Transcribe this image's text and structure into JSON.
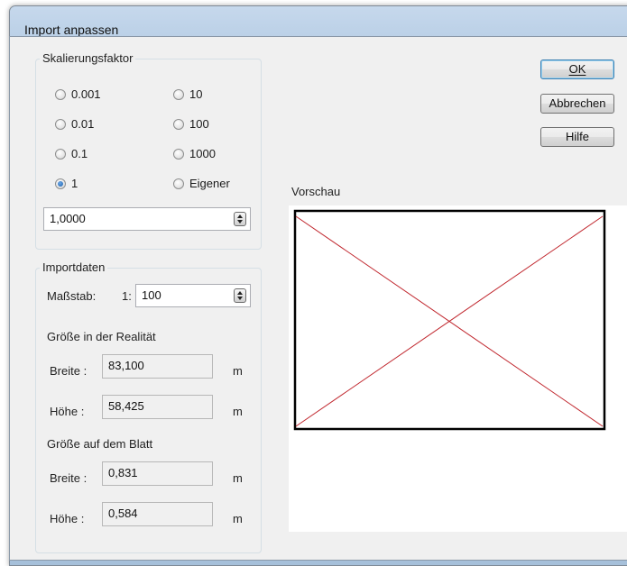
{
  "window": {
    "title": "Import anpassen"
  },
  "scale_group": {
    "legend": "Skalierungsfaktor",
    "options": [
      "0.001",
      "0.01",
      "0.1",
      "1",
      "10",
      "100",
      "1000",
      "Eigener"
    ],
    "selected": "1",
    "value": "1,0000"
  },
  "import_group": {
    "legend": "Importdaten",
    "scale_label": "Maßstab:",
    "scale_prefix": "1:",
    "scale_value": "100",
    "reality_heading": "Größe in der Realität",
    "sheet_heading": "Größe auf dem Blatt",
    "width_label": "Breite :",
    "height_label": "Höhe :",
    "unit": "m",
    "reality_width": "83,100",
    "reality_height": "58,425",
    "sheet_width": "0,831",
    "sheet_height": "0,584"
  },
  "buttons": {
    "ok": "OK",
    "cancel": "Abbrechen",
    "help": "Hilfe"
  },
  "preview": {
    "label": "Vorschau",
    "frame_color": "#000000",
    "cross_color": "#c0262d"
  }
}
